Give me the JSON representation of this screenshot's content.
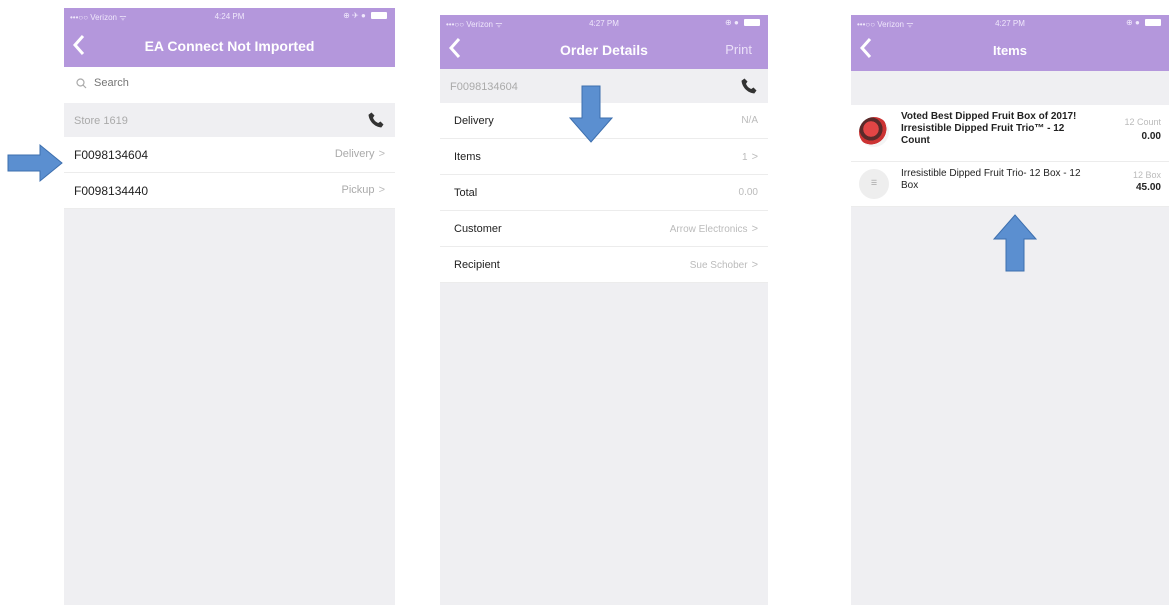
{
  "screen1": {
    "status": {
      "carrier": "•••○○ Verizon ᯤ",
      "time": "4:24 PM"
    },
    "title": "EA Connect Not Imported",
    "search_placeholder": "Search",
    "section": "Store 1619",
    "rows": [
      {
        "id": "F0098134604",
        "type": "Delivery"
      },
      {
        "id": "F0098134440",
        "type": "Pickup"
      }
    ]
  },
  "screen2": {
    "status": {
      "carrier": "•••○○ Verizon ᯤ",
      "time": "4:27 PM"
    },
    "title": "Order Details",
    "print": "Print",
    "section": "F0098134604",
    "rows": [
      {
        "label": "Delivery",
        "value": "N/A",
        "chevron": false
      },
      {
        "label": "Items",
        "value": "1",
        "chevron": true
      },
      {
        "label": "Total",
        "value": "0.00",
        "chevron": false
      },
      {
        "label": "Customer",
        "value": "Arrow Electronics",
        "chevron": true
      },
      {
        "label": "Recipient",
        "value": "Sue Schober",
        "chevron": true
      }
    ]
  },
  "screen3": {
    "status": {
      "carrier": "•••○○ Verizon ᯤ",
      "time": "4:27 PM"
    },
    "title": "Items",
    "items": [
      {
        "name": "Voted Best Dipped Fruit Box of 2017! Irresistible Dipped Fruit Trio™ - 12 Count",
        "qty": "12 Count",
        "price": "0.00"
      },
      {
        "name": "Irresistible Dipped Fruit Trio- 12 Box - 12 Box",
        "qty": "12 Box",
        "price": "45.00"
      }
    ]
  },
  "colors": {
    "nav": "#b497dc",
    "arrow": "#5b8fd0",
    "background": "#efeff2"
  },
  "icons": [
    "back-icon",
    "search-icon",
    "phone-icon",
    "chevron-right-icon",
    "arrow-right-icon",
    "arrow-down-icon",
    "arrow-up-icon"
  ]
}
